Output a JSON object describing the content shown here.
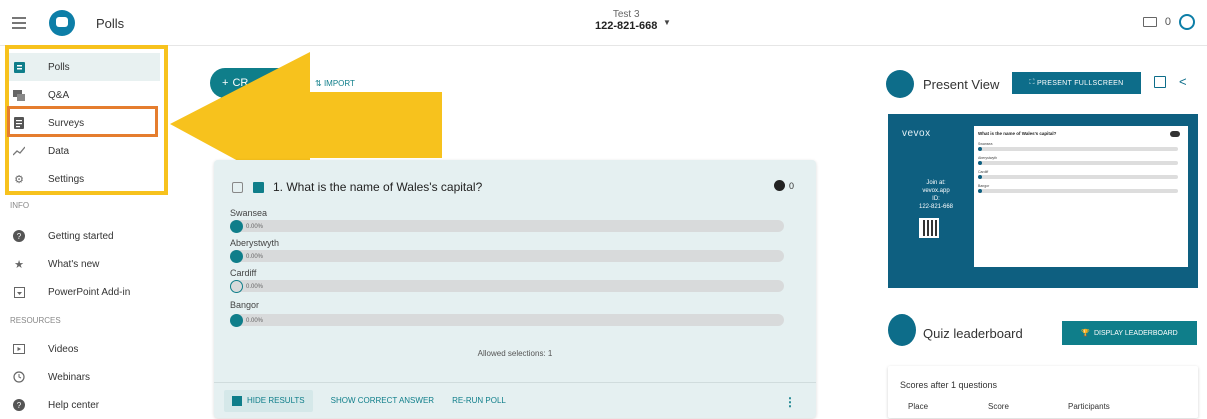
{
  "topbar": {
    "app_title": "Polls",
    "session_name": "Test 3",
    "session_id": "122-821-668",
    "participant_count": "0"
  },
  "sidebar": {
    "items": [
      {
        "label": "Polls",
        "icon": "poll-icon",
        "active": true
      },
      {
        "label": "Q&A",
        "icon": "qa-icon"
      },
      {
        "label": "Surveys",
        "icon": "survey-icon"
      },
      {
        "label": "Data",
        "icon": "chart-icon"
      },
      {
        "label": "Settings",
        "icon": "gear-icon"
      }
    ],
    "info_heading": "INFO",
    "info_items": [
      {
        "label": "Getting started",
        "icon": "help-icon"
      },
      {
        "label": "What's new",
        "icon": "star-icon"
      },
      {
        "label": "PowerPoint Add-in",
        "icon": "addin-icon"
      }
    ],
    "resources_heading": "RESOURCES",
    "resource_items": [
      {
        "label": "Videos",
        "icon": "video-icon"
      },
      {
        "label": "Webinars",
        "icon": "clock-icon"
      },
      {
        "label": "Help center",
        "icon": "help-icon"
      }
    ]
  },
  "toolbar": {
    "create_label": "CR",
    "import_label": "IMPORT"
  },
  "poll": {
    "question": "1. What is the name of Wales's capital?",
    "participants": "0",
    "options": [
      {
        "label": "Swansea",
        "percent": "0.00%",
        "correct": false,
        "fill": 0
      },
      {
        "label": "Aberystwyth",
        "percent": "0.00%",
        "correct": false,
        "fill": 0
      },
      {
        "label": "Cardiff",
        "percent": "0.00%",
        "correct": true,
        "fill": 0
      },
      {
        "label": "Bangor",
        "percent": "0.00%",
        "correct": false,
        "fill": 0
      }
    ],
    "allowed_selections": "Allowed selections: 1",
    "footer": {
      "hide_results": "HIDE RESULTS",
      "show_correct": "SHOW CORRECT ANSWER",
      "rerun": "RE-RUN POLL"
    }
  },
  "present": {
    "title": "Present View",
    "fullscreen_label": "PRESENT FULLSCREEN",
    "preview": {
      "brand": "vevox",
      "join_line1": "Join at:",
      "join_line2": "vevox.app",
      "id_label": "ID:",
      "id_value": "122-821-668",
      "question": "What is the name of Wales's capital?",
      "options": [
        "Swansea",
        "Aberystwyth",
        "Cardiff",
        "Bangor"
      ]
    }
  },
  "quiz": {
    "title": "Quiz leaderboard",
    "display_label": "DISPLAY LEADERBOARD",
    "scores_title": "Scores after 1 questions",
    "columns": [
      "Place",
      "Score",
      "Participants"
    ]
  },
  "colors": {
    "accent": "#0f7e8a",
    "highlight_yellow": "#f7c21d",
    "highlight_orange": "#e57d2e",
    "preview_bg": "#0e5f80"
  }
}
